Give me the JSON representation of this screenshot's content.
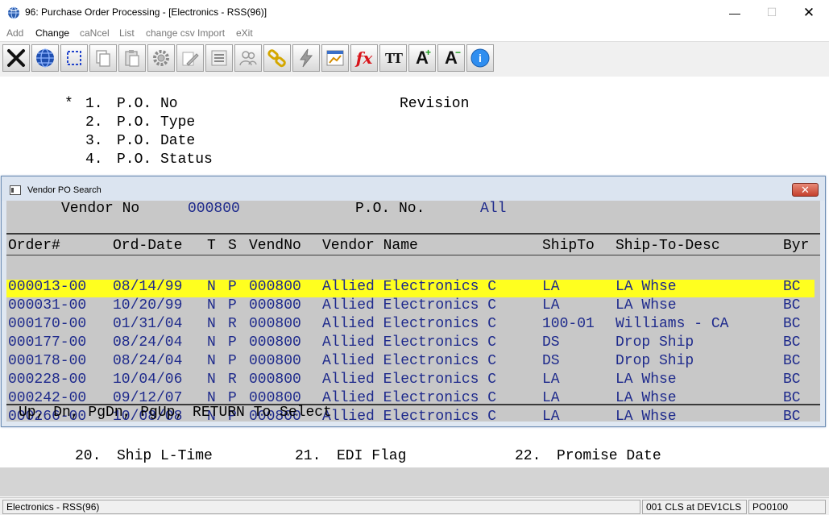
{
  "window": {
    "title": "96: Purchase Order Processing - [Electronics - RSS(96)]",
    "minimize_glyph": "—",
    "maximize_glyph": "☐",
    "close_glyph": "✕"
  },
  "menu": [
    {
      "label": "Add",
      "enabled": false
    },
    {
      "label": "Change",
      "enabled": true
    },
    {
      "label": "caNcel",
      "enabled": false
    },
    {
      "label": "List",
      "enabled": false
    },
    {
      "label": "change csv Import",
      "enabled": false
    },
    {
      "label": "eXit",
      "enabled": false
    }
  ],
  "toolbar": {
    "icons": [
      "cancel-x-icon",
      "globe-icon",
      "select-box-icon",
      "copy-icon",
      "paste-icon",
      "settings-gear-icon",
      "edit-icon",
      "list-icon",
      "users-icon",
      "link-icon",
      "lightning-icon",
      "chart-icon",
      "fx-icon",
      "text-size-icon",
      "font-increase-icon",
      "font-decrease-icon",
      "help-icon"
    ],
    "fx_label": "fx",
    "tt_label": "TT",
    "font_up_label": "A",
    "font_down_label": "A"
  },
  "form": {
    "marker": "*",
    "fields": [
      {
        "num": "1.",
        "label": "P.O. No"
      },
      {
        "num": "2.",
        "label": "P.O. Type"
      },
      {
        "num": "3.",
        "label": "P.O. Date"
      },
      {
        "num": "4.",
        "label": "P.O. Status"
      }
    ],
    "revision_label": "Revision",
    "bottom_fields": [
      {
        "num": "20.",
        "label": "Ship L-Time"
      },
      {
        "num": "21.",
        "label": "EDI Flag"
      },
      {
        "num": "22.",
        "label": "Promise Date"
      }
    ]
  },
  "dialog": {
    "title": "Vendor PO Search",
    "close_glyph": "✕",
    "vendor_label": "Vendor No",
    "vendor_value": "000800",
    "po_label": "P.O. No.",
    "po_value": "All",
    "columns": [
      "Order#",
      "Ord-Date",
      "T",
      "S",
      "VendNo",
      "Vendor Name",
      "ShipTo",
      "Ship-To-Desc",
      "Byr"
    ],
    "rows": [
      {
        "order": "000013-00",
        "date": "08/14/99",
        "t": "N",
        "s": "P",
        "vendno": "000800",
        "vendor": "Allied Electronics C",
        "shipto": "LA",
        "desc": "LA Whse",
        "byr": "BC",
        "selected": true
      },
      {
        "order": "000031-00",
        "date": "10/20/99",
        "t": "N",
        "s": "P",
        "vendno": "000800",
        "vendor": "Allied Electronics C",
        "shipto": "LA",
        "desc": "LA Whse",
        "byr": "BC"
      },
      {
        "order": "000170-00",
        "date": "01/31/04",
        "t": "N",
        "s": "R",
        "vendno": "000800",
        "vendor": "Allied Electronics C",
        "shipto": "100-01",
        "desc": "Williams - CA",
        "byr": "BC"
      },
      {
        "order": "000177-00",
        "date": "08/24/04",
        "t": "N",
        "s": "P",
        "vendno": "000800",
        "vendor": "Allied Electronics C",
        "shipto": "DS",
        "desc": "Drop Ship",
        "byr": "BC"
      },
      {
        "order": "000178-00",
        "date": "08/24/04",
        "t": "N",
        "s": "P",
        "vendno": "000800",
        "vendor": "Allied Electronics C",
        "shipto": "DS",
        "desc": "Drop Ship",
        "byr": "BC"
      },
      {
        "order": "000228-00",
        "date": "10/04/06",
        "t": "N",
        "s": "R",
        "vendno": "000800",
        "vendor": "Allied Electronics C",
        "shipto": "LA",
        "desc": "LA Whse",
        "byr": "BC"
      },
      {
        "order": "000242-00",
        "date": "09/12/07",
        "t": "N",
        "s": "P",
        "vendno": "000800",
        "vendor": "Allied Electronics C",
        "shipto": "LA",
        "desc": "LA Whse",
        "byr": "BC"
      },
      {
        "order": "000266-00",
        "date": "10/08/08",
        "t": "N",
        "s": "P",
        "vendno": "000800",
        "vendor": "Allied Electronics C",
        "shipto": "LA",
        "desc": "LA Whse",
        "byr": "BC"
      }
    ],
    "footer": "Up, Dn, PgDn, PgUp, RETURN To Select"
  },
  "status": {
    "company": "Electronics - RSS(96)",
    "session": "001 CLS at DEV1CLS",
    "program": "PO0100"
  },
  "colors": {
    "selected_row": "#ffff1f",
    "value_text": "#1e2a8c",
    "dialog_body": "#c8c8c8"
  }
}
